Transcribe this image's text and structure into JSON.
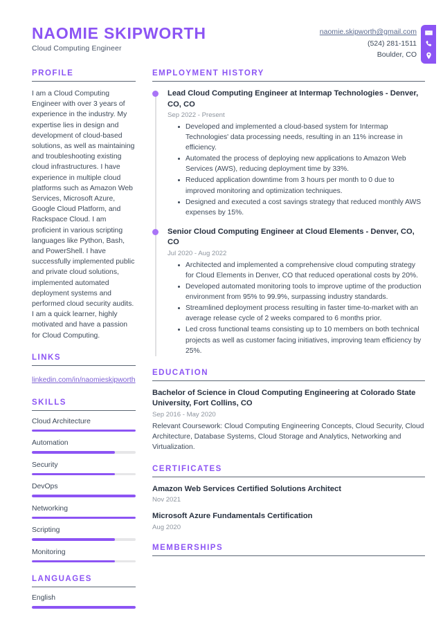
{
  "header": {
    "name": "NAOMIE SKIPWORTH",
    "job_title": "Cloud Computing Engineer",
    "email": "naomie.skipworth@gmail.com",
    "phone": "(524) 281-1511",
    "location": "Boulder, CO",
    "icons": [
      "envelope-icon",
      "phone-icon",
      "location-pin-icon"
    ],
    "accent_color": "#8c54f4"
  },
  "sidebar": {
    "profile": {
      "heading": "PROFILE",
      "text": "I am a Cloud Computing Engineer with over 3 years of experience in the industry. My expertise lies in design and development of cloud-based solutions, as well as maintaining and troubleshooting existing cloud infrastructures. I have experience in multiple cloud platforms such as Amazon Web Services, Microsoft Azure, Google Cloud Platform, and Rackspace Cloud. I am proficient in various scripting languages like Python, Bash, and PowerShell. I have successfully implemented public and private cloud solutions, implemented automated deployment systems and performed cloud security audits. I am a quick learner, highly motivated and have a passion for Cloud Computing."
    },
    "links": {
      "heading": "LINKS",
      "items": [
        {
          "label": "linkedin.com/in/naomieskipworth"
        }
      ]
    },
    "skills": {
      "heading": "SKILLS",
      "items": [
        {
          "label": "Cloud Architecture",
          "level": 100
        },
        {
          "label": "Automation",
          "level": 80
        },
        {
          "label": "Security",
          "level": 80
        },
        {
          "label": "DevOps",
          "level": 100
        },
        {
          "label": "Networking",
          "level": 100
        },
        {
          "label": "Scripting",
          "level": 80
        },
        {
          "label": "Monitoring",
          "level": 80
        }
      ]
    },
    "languages": {
      "heading": "LANGUAGES",
      "items": [
        {
          "label": "English",
          "level": 100
        }
      ]
    }
  },
  "main": {
    "employment": {
      "heading": "EMPLOYMENT HISTORY",
      "jobs": [
        {
          "title": "Lead Cloud Computing Engineer at Intermap Technologies - Denver, CO, CO",
          "date": "Sep 2022 - Present",
          "bullets": [
            "Developed and implemented a cloud-based system for Intermap Technologies' data processing needs, resulting in an 11% increase in efficiency.",
            "Automated the process of deploying new applications to Amazon Web Services (AWS), reducing deployment time by 33%.",
            "Reduced application downtime from 3 hours per month to 0 due to improved monitoring and optimization techniques.",
            "Designed and executed a cost savings strategy that reduced monthly AWS expenses by 15%."
          ]
        },
        {
          "title": "Senior Cloud Computing Engineer at Cloud Elements - Denver, CO, CO",
          "date": "Jul 2020 - Aug 2022",
          "bullets": [
            "Architected and implemented a comprehensive cloud computing strategy for Cloud Elements in Denver, CO that reduced operational costs by 20%.",
            "Developed automated monitoring tools to improve uptime of the production environment from 95% to 99.9%, surpassing industry standards.",
            "Streamlined deployment process resulting in faster time-to-market with an average release cycle of 2 weeks compared to 6 months prior.",
            "Led cross functional teams consisting up to 10 members on both technical projects as well as customer facing initiatives, improving team efficiency by 25%."
          ]
        }
      ]
    },
    "education": {
      "heading": "EDUCATION",
      "items": [
        {
          "title": "Bachelor of Science in Cloud Computing Engineering at Colorado State University, Fort Collins, CO",
          "date": "Sep 2016 - May 2020",
          "description": "Relevant Coursework: Cloud Computing Engineering Concepts, Cloud Security, Cloud Architecture, Database Systems, Cloud Storage and Analytics, Networking and Virtualization."
        }
      ]
    },
    "certificates": {
      "heading": "CERTIFICATES",
      "items": [
        {
          "title": "Amazon Web Services Certified Solutions Architect",
          "date": "Nov 2021"
        },
        {
          "title": "Microsoft Azure Fundamentals Certification",
          "date": "Aug 2020"
        }
      ]
    },
    "memberships": {
      "heading": "MEMBERSHIPS"
    }
  }
}
